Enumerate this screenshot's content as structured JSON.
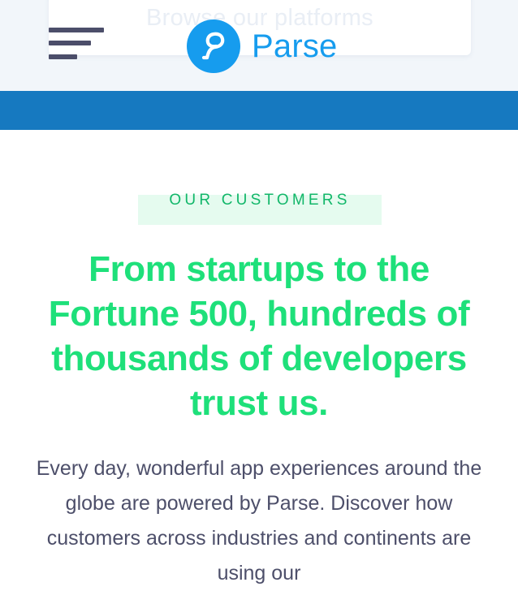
{
  "header": {
    "browse_text": "Browse our platforms",
    "logo_text": "Parse",
    "brand_color": "#169cee",
    "band_color": "#1679c0"
  },
  "section": {
    "eyebrow": "OUR CUSTOMERS",
    "headline_regular": "From startups to the Fortune 500, hundreds of thousands of developers ",
    "headline_bold": "trust us.",
    "accent_color": "#1ee07a",
    "body": "Every day, wonderful app experiences around the globe are powered by Parse. Discover how customers across industries and continents are using our"
  },
  "icons": {
    "menu": "hamburger-menu-icon",
    "logo": "parse-logo-icon"
  }
}
